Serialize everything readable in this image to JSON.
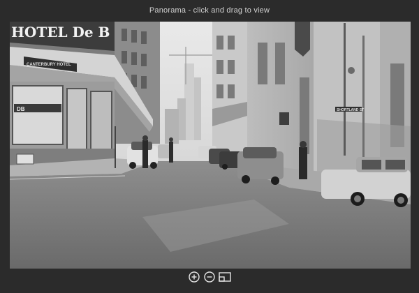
{
  "viewer": {
    "title": "Panorama - click and drag to view"
  },
  "photo": {
    "hotel_sign": "HOTEL De B",
    "awning_text": "CANTERBURY HOTEL",
    "window_text": "DB",
    "street_sign": "SHORTLAND ST",
    "colors": {
      "background": "#2b2b2b",
      "title_text": "#d2d2d2",
      "control_icon": "#e6e6e6"
    }
  },
  "controls": {
    "zoom_in": "zoom-in-icon",
    "zoom_out": "zoom-out-icon",
    "fullscreen": "fullscreen-icon"
  }
}
